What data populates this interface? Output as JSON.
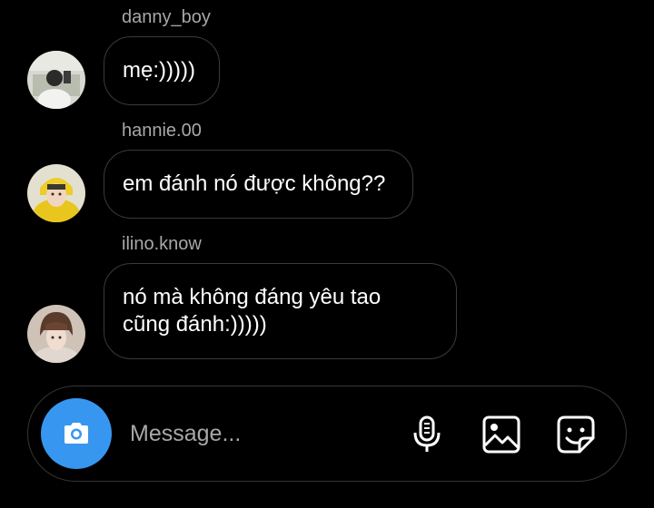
{
  "messages": [
    {
      "sender": "danny_boy",
      "text": "mẹ:)))))"
    },
    {
      "sender": "hannie.00",
      "text": "em đánh nó được không??"
    },
    {
      "sender": "ilino.know",
      "text": "nó mà không đáng yêu tao\ncũng đánh:)))))"
    }
  ],
  "composer": {
    "placeholder": "Message...",
    "value": "",
    "camera_icon": "camera-icon",
    "mic_icon": "microphone-icon",
    "gallery_icon": "image-gallery-icon",
    "sticker_icon": "sticker-icon"
  },
  "colors": {
    "background": "#000000",
    "bubble_border": "#3a3a3a",
    "sender_text": "#a8a8a8",
    "accent": "#3797f0"
  }
}
